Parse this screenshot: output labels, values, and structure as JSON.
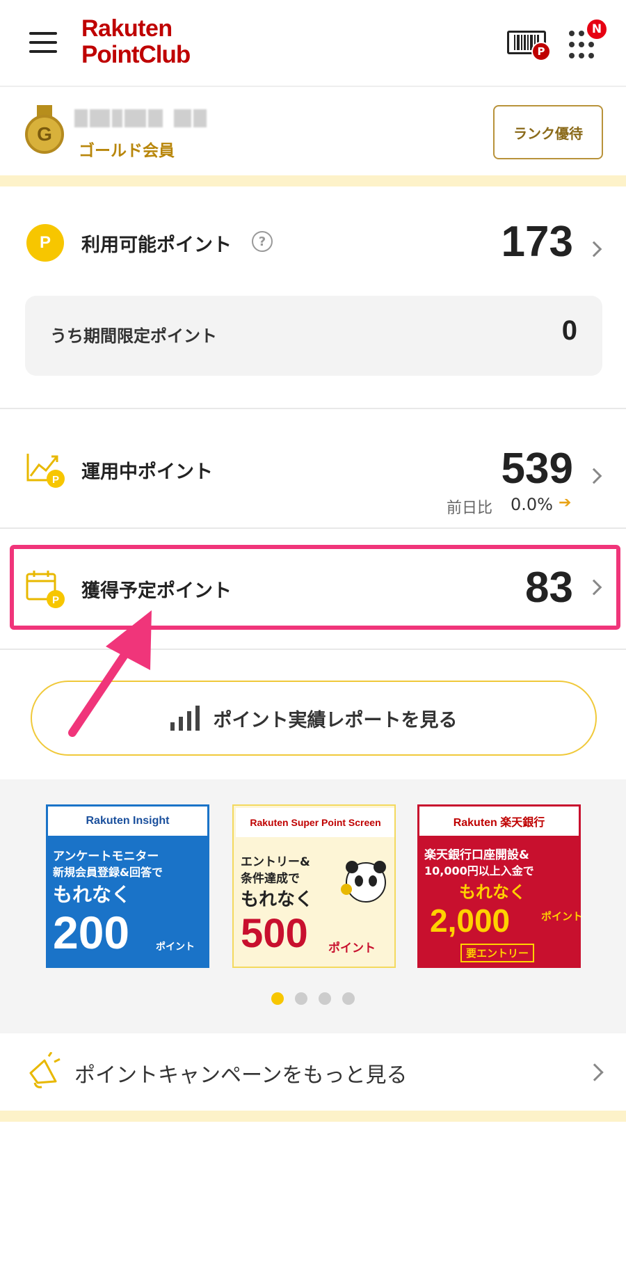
{
  "header": {
    "logo_line1": "Rakuten",
    "logo_line2": "PointClub",
    "barcode_badge": "P",
    "notification_badge": "N"
  },
  "member": {
    "medal_letter": "G",
    "rank": "ゴールド会員",
    "rank_benefits_button": "ランク優待"
  },
  "available_points": {
    "label": "利用可能ポイント",
    "help": "?",
    "value": "173",
    "coin": "P",
    "limited": {
      "label": "うち期間限定ポイント",
      "value": "0"
    }
  },
  "invested_points": {
    "label": "運用中ポイント",
    "value": "539",
    "change_label": "前日比",
    "change_value": "0.0%",
    "change_arrow": "➔"
  },
  "pending_points": {
    "label": "獲得予定ポイント",
    "value": "83"
  },
  "report_button": {
    "label": "ポイント実績レポートを見る"
  },
  "banners": [
    {
      "header": "Rakuten Insight",
      "line1": "アンケートモニター",
      "line2": "新規会員登録&回答で",
      "line3": "もれなく",
      "big": "200",
      "unit": "ポイント",
      "color": "#1a73c8"
    },
    {
      "header": "Rakuten Super Point Screen",
      "line1": "エントリー&",
      "line2": "条件達成で",
      "line3": "もれなく",
      "big": "500",
      "unit": "ポイント",
      "color": "#fdf5d6"
    },
    {
      "header": "Rakuten 楽天銀行",
      "line1": "楽天銀行口座開設&",
      "line2": "10,000円以上入金で",
      "line3": "もれなく",
      "big": "2,000",
      "unit": "ポイント",
      "note": "要エントリー",
      "color": "#c8102e"
    }
  ],
  "carousel": {
    "count": 4,
    "active": 1
  },
  "campaign": {
    "label": "ポイントキャンペーンをもっと見る"
  },
  "colors": {
    "brand_red": "#bf0000",
    "gold": "#b8860b",
    "point_yellow": "#f7c600",
    "highlight_pink": "#f0357a",
    "band_cream": "#fdf2c9"
  }
}
